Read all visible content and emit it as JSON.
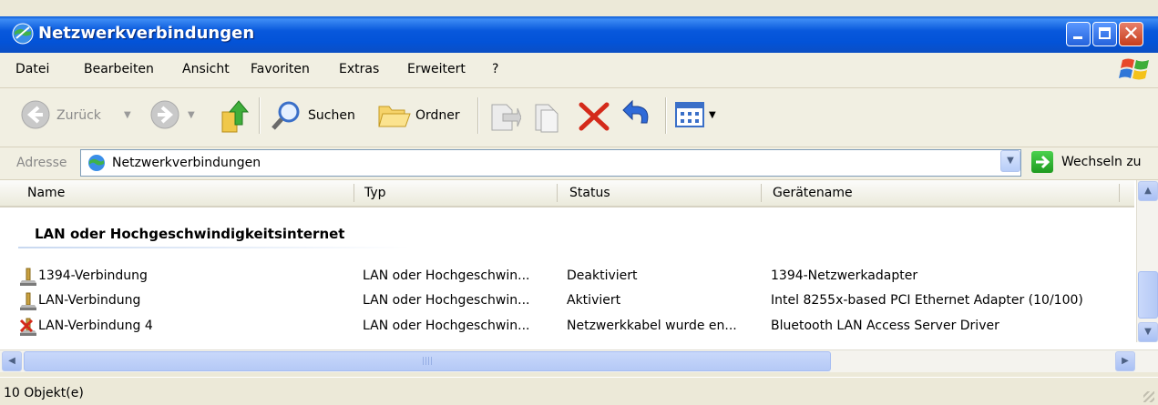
{
  "window": {
    "title": "Netzwerkverbindungen",
    "icon": "network-connections-icon"
  },
  "menu": [
    "Datei",
    "Bearbeiten",
    "Ansicht",
    "Favoriten",
    "Extras",
    "Erweitert",
    "?"
  ],
  "toolbar": {
    "back_label": "Zurück",
    "search_label": "Suchen",
    "folders_label": "Ordner"
  },
  "address": {
    "label": "Adresse",
    "value": "Netzwerkverbindungen",
    "go_label": "Wechseln zu"
  },
  "columns": [
    "Name",
    "Typ",
    "Status",
    "Gerätename"
  ],
  "group": {
    "title": "LAN oder Hochgeschwindigkeitsinternet"
  },
  "rows": [
    {
      "name": "1394-Verbindung",
      "type": "LAN oder Hochgeschwin...",
      "status": "Deaktiviert",
      "device": "1394-Netzwerkadapter",
      "icon": "network-connection-icon"
    },
    {
      "name": "LAN-Verbindung",
      "type": "LAN oder Hochgeschwin...",
      "status": "Aktiviert",
      "device": "Intel 8255x-based PCI Ethernet Adapter (10/100)",
      "icon": "network-connection-icon"
    },
    {
      "name": "LAN-Verbindung 4",
      "type": "LAN oder Hochgeschwin...",
      "status": "Netzwerkkabel wurde en...",
      "device": "Bluetooth LAN Access Server Driver",
      "icon": "network-disconnected-icon"
    }
  ],
  "status": {
    "text": "10 Objekt(e)"
  },
  "colors": {
    "titlebar": "#0858dc",
    "chrome": "#ece9d8",
    "error_red": "#d42a1a"
  }
}
